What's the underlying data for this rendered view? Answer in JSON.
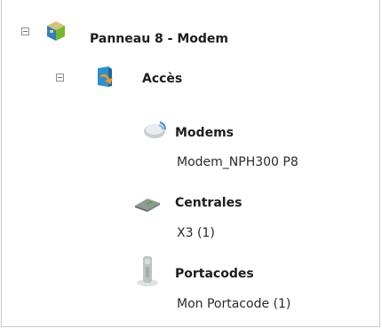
{
  "tree": {
    "root": {
      "label": "Panneau 8 - Modem",
      "icon": "panel-icon",
      "expanded": true
    },
    "group": {
      "label": "Accès",
      "icon": "access-door-icon",
      "expanded": true
    },
    "categories": [
      {
        "label": "Modems",
        "icon": "modem-icon",
        "item": "Modem_NPH300 P8"
      },
      {
        "label": "Centrales",
        "icon": "central-unit-icon",
        "item": "X3 (1)"
      },
      {
        "label": "Portacodes",
        "icon": "portacode-icon",
        "item": "Mon Portacode (1)"
      }
    ]
  }
}
